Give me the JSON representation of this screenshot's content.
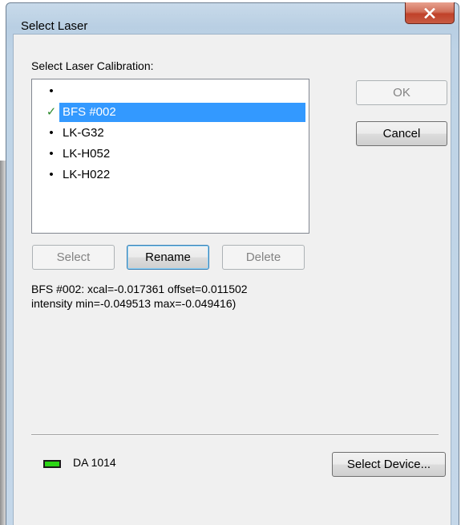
{
  "window": {
    "title": "Select Laser",
    "close_icon": "close-x-icon"
  },
  "calibration": {
    "label": "Select Laser Calibration:",
    "items": [
      {
        "marker": "•",
        "label": "",
        "selected": false
      },
      {
        "marker": "✓",
        "label": "BFS #002",
        "selected": true
      },
      {
        "marker": "•",
        "label": "LK-G32",
        "selected": false
      },
      {
        "marker": "•",
        "label": "LK-H052",
        "selected": false
      },
      {
        "marker": "•",
        "label": "LK-H022",
        "selected": false
      }
    ]
  },
  "buttons": {
    "ok": "OK",
    "cancel": "Cancel",
    "select": "Select",
    "rename": "Rename",
    "delete": "Delete",
    "select_device": "Select Device..."
  },
  "details": {
    "line1": "BFS #002: xcal=-0.017361 offset=0.011502",
    "line2": "intensity min=-0.049513 max=-0.049416)"
  },
  "device": {
    "name": "DA 1014",
    "status_color": "#2cd616"
  },
  "colors": {
    "selection": "#3399ff",
    "check": "#2e8b2e"
  }
}
